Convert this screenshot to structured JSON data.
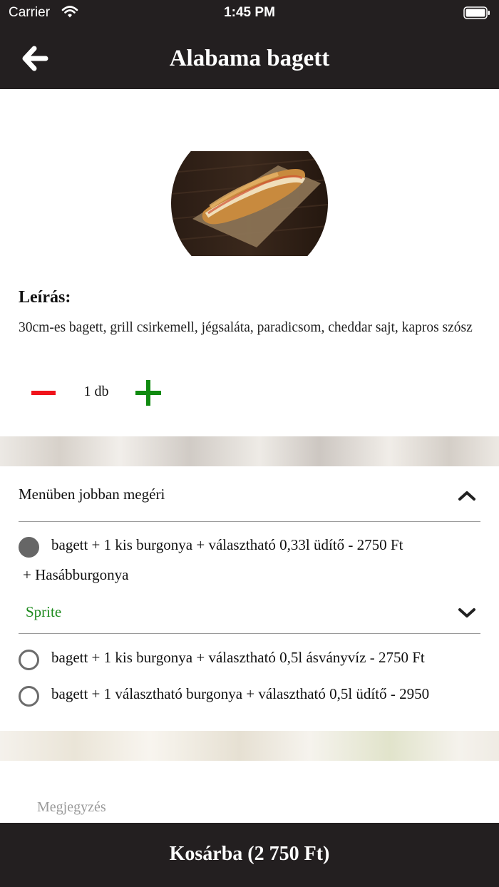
{
  "status_bar": {
    "carrier": "Carrier",
    "time": "1:45 PM"
  },
  "header": {
    "title": "Alabama bagett",
    "back_icon": "arrow-left-icon"
  },
  "product": {
    "image": "baguette-photo",
    "description_title": "Leírás:",
    "description": "30cm-es bagett, grill csirkemell, jégsaláta, paradicsom, cheddar sajt, kapros szósz",
    "quantity": "1 db"
  },
  "menu_section": {
    "title": "Menüben jobban megéri",
    "options": [
      {
        "label": "bagett + 1 kis burgonya + választható 0,33l üdítő - 2750 Ft",
        "selected": true
      },
      {
        "label": "bagett + 1 kis burgonya + választható 0,5l ásványvíz - 2750 Ft",
        "selected": false
      },
      {
        "label": "bagett + 1 választható burgonya + választható 0,5l üdítő - 2950",
        "selected": false
      }
    ],
    "extra": "+ Hasábburgonya",
    "drink_selected": "Sprite"
  },
  "note": {
    "placeholder": "Megjegyzés"
  },
  "cart": {
    "label": "Kosárba (2 750 Ft)"
  },
  "colors": {
    "dark": "#231f20",
    "minus": "#f0131b",
    "plus": "#0f8a0f",
    "drink_text": "#1d8a1d"
  }
}
